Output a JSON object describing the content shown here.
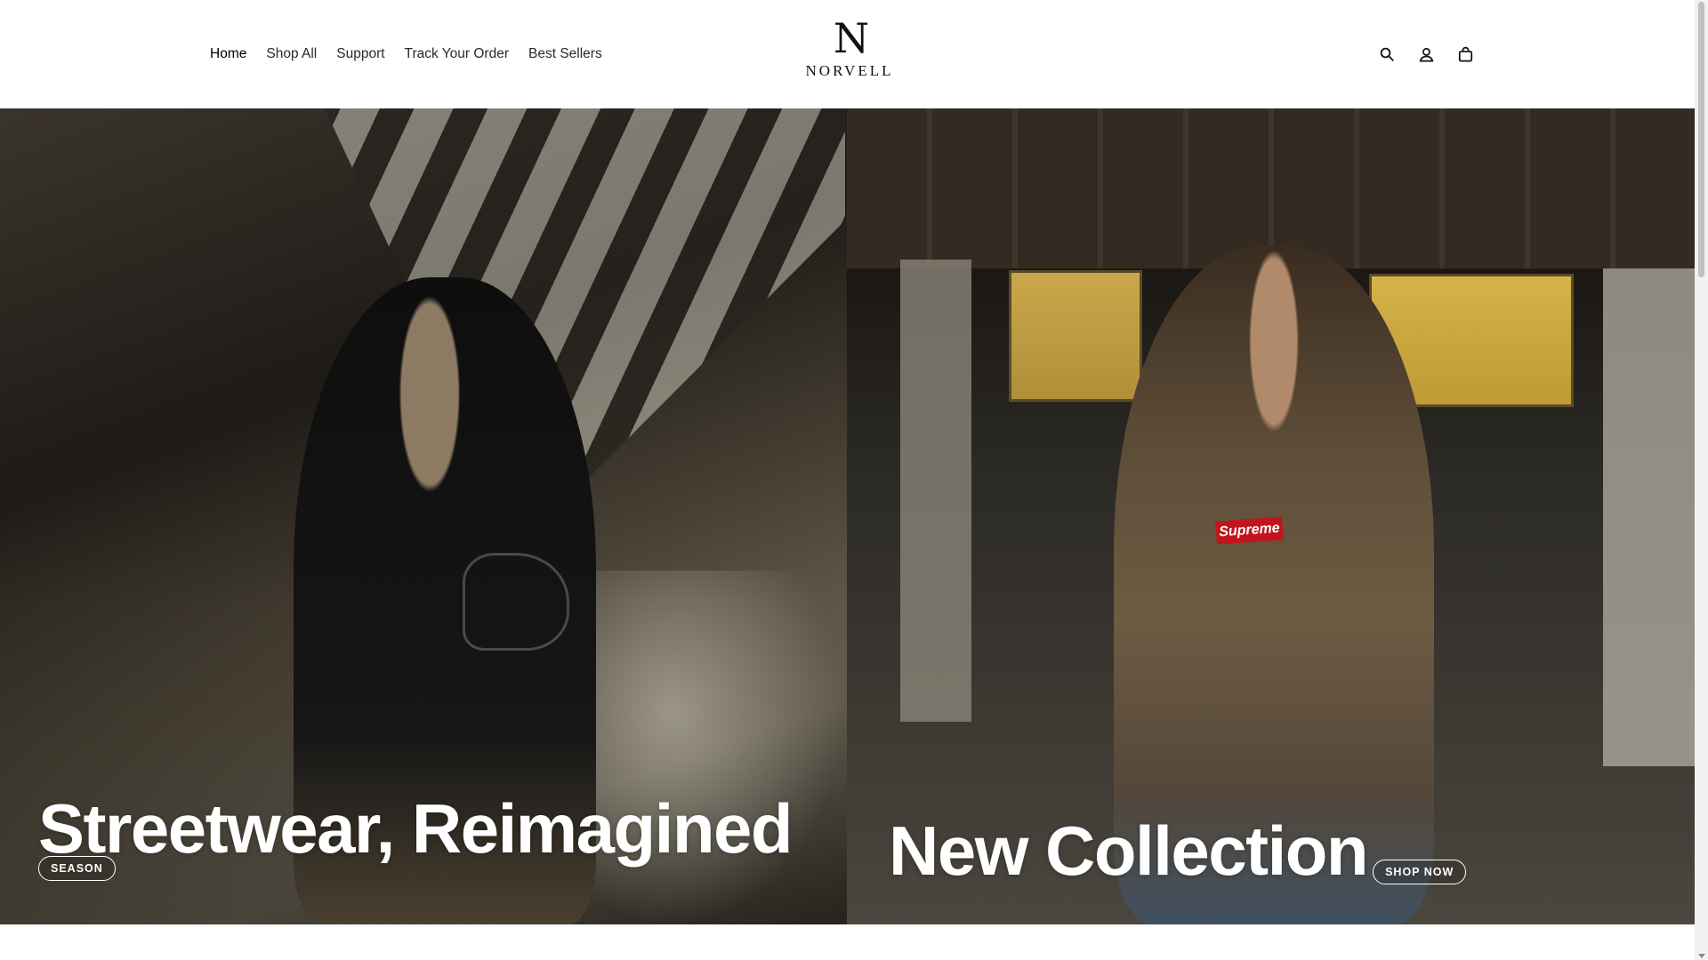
{
  "nav": {
    "items": [
      {
        "label": "Home",
        "active": true
      },
      {
        "label": "Shop All"
      },
      {
        "label": "Support"
      },
      {
        "label": "Track Your Order"
      },
      {
        "label": "Best Sellers"
      }
    ]
  },
  "logo": {
    "mark": "N",
    "word": "NORVELL"
  },
  "header_icons": [
    "search-icon",
    "account-icon",
    "cart-icon"
  ],
  "hero": {
    "left": {
      "title": "Streetwear, Reimagined",
      "pill": "SEASON"
    },
    "right": {
      "title": "New Collection",
      "pill": "SHOP NOW",
      "print": "Supreme"
    }
  }
}
